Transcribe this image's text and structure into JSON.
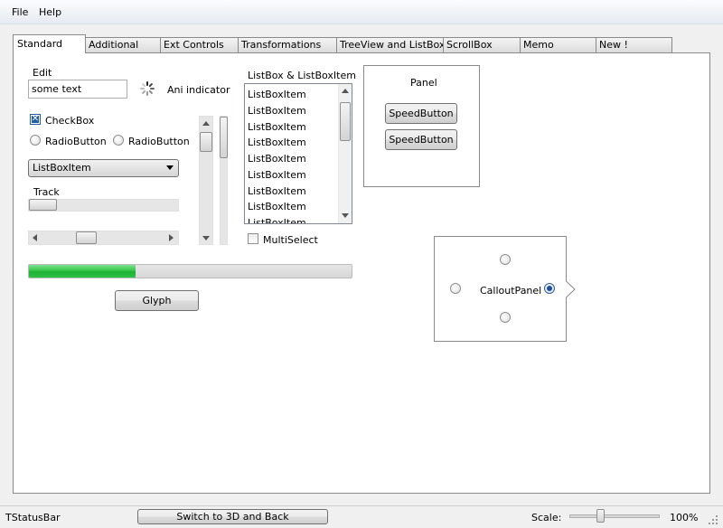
{
  "menu": {
    "file": "File",
    "help": "Help"
  },
  "tabs": [
    "Standard",
    "Additional",
    "Ext Controls",
    "Transformations",
    "TreeView and ListBox",
    "ScrollBox",
    "Memo",
    "New !"
  ],
  "standard": {
    "edit_label": "Edit",
    "edit_value": "some text",
    "ani_indicator_label": "Ani indicator",
    "checkbox_label": "CheckBox",
    "radio1_label": "RadioButton",
    "radio2_label": "RadioButton",
    "combo_value": "ListBoxItem",
    "track_label": "Track",
    "listbox_title": "ListBox & ListBoxItem",
    "listbox_items": [
      "ListBoxItem",
      "ListBoxItem",
      "ListBoxItem",
      "ListBoxItem",
      "ListBoxItem",
      "ListBoxItem",
      "ListBoxItem",
      "ListBoxItem",
      "ListBoxItem"
    ],
    "multiselect_label": "MultiSelect",
    "progress_fraction": 0.33,
    "glyph_label": "Glyph",
    "panel_label": "Panel",
    "speedbutton1": "SpeedButton",
    "speedbutton2": "SpeedButton",
    "callout_label": "CalloutPanel"
  },
  "statusbar": {
    "label": "TStatusBar",
    "switch_button": "Switch to 3D and Back",
    "scale_label": "Scale:",
    "scale_value": "100%"
  }
}
